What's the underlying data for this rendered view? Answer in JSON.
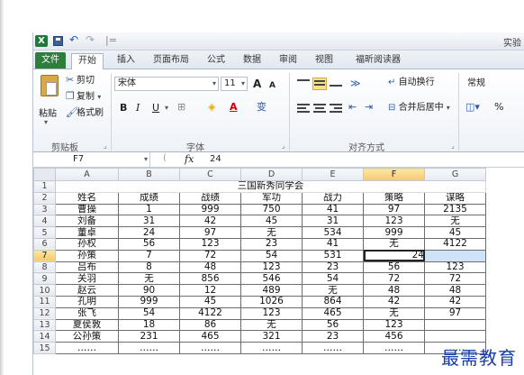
{
  "app": {
    "logo_letter": "X",
    "window_title": "实验",
    "undo_glyph": "↶",
    "redo_glyph": "↷",
    "qat_sep": "|="
  },
  "tabs": [
    "文件",
    "开始",
    "插入",
    "页面布局",
    "公式",
    "数据",
    "审阅",
    "视图",
    "福昕阅读器"
  ],
  "ribbon": {
    "clipboard": {
      "paste": "粘贴",
      "cut": "剪切",
      "copy": "复制",
      "format_painter": "格式刷",
      "group": "剪贴板"
    },
    "font": {
      "name": "宋体",
      "size": "11",
      "grow": "A",
      "shrink": "A",
      "bold": "B",
      "italic": "I",
      "underline": "U",
      "phonetic": "变",
      "group": "字体"
    },
    "alignment": {
      "wrap": "自动换行",
      "merge": "合并后居中",
      "group": "对齐方式"
    },
    "number": {
      "format": "常规"
    }
  },
  "formula_bar": {
    "name_box": "F7",
    "fx": "fx",
    "value": "24"
  },
  "sheet": {
    "columns": [
      "A",
      "B",
      "C",
      "D",
      "E",
      "F",
      "G"
    ],
    "selected_column": "F",
    "selected_row": "7",
    "title": "三国新秀同学会",
    "header": [
      "姓名",
      "成绩",
      "战绩",
      "军功",
      "战力",
      "策略",
      "谋略"
    ],
    "rows": [
      {
        "n": "3",
        "cells": [
          "曹操",
          "1",
          "999",
          "750",
          "41",
          "97",
          "2135"
        ]
      },
      {
        "n": "4",
        "cells": [
          "刘备",
          "31",
          "42",
          "45",
          "31",
          "123",
          "无"
        ]
      },
      {
        "n": "5",
        "cells": [
          "董卓",
          "24",
          "97",
          "无",
          "534",
          "999",
          "45"
        ]
      },
      {
        "n": "6",
        "cells": [
          "孙权",
          "56",
          "123",
          "23",
          "41",
          "无",
          "4122"
        ]
      },
      {
        "n": "7",
        "cells": [
          "孙策",
          "7",
          "72",
          "54",
          "531",
          "24",
          ""
        ]
      },
      {
        "n": "8",
        "cells": [
          "吕布",
          "8",
          "48",
          "123",
          "23",
          "56",
          "123"
        ]
      },
      {
        "n": "9",
        "cells": [
          "关羽",
          "无",
          "856",
          "546",
          "54",
          "72",
          "72"
        ]
      },
      {
        "n": "10",
        "cells": [
          "赵云",
          "90",
          "12",
          "489",
          "无",
          "48",
          "48"
        ]
      },
      {
        "n": "11",
        "cells": [
          "孔明",
          "999",
          "45",
          "1026",
          "864",
          "42",
          "42"
        ]
      },
      {
        "n": "12",
        "cells": [
          "张飞",
          "54",
          "4122",
          "123",
          "465",
          "无",
          "97"
        ]
      },
      {
        "n": "13",
        "cells": [
          "夏侯敦",
          "18",
          "86",
          "无",
          "56",
          "123",
          ""
        ]
      },
      {
        "n": "14",
        "cells": [
          "公孙策",
          "231",
          "465",
          "321",
          "23",
          "456",
          ""
        ]
      },
      {
        "n": "15",
        "cells": [
          "……",
          "……",
          "……",
          "……",
          "……",
          "……",
          "……"
        ]
      }
    ]
  },
  "watermark": "最需教育"
}
